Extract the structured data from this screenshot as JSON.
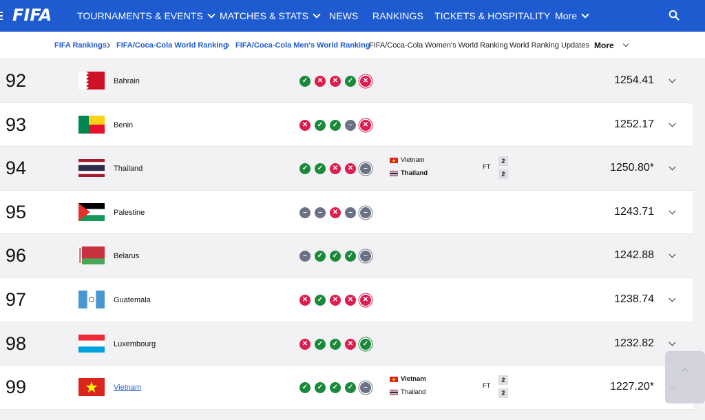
{
  "nav": {
    "logo": "FIFA",
    "items": [
      {
        "label": "TOURNAMENTS & EVENTS",
        "dropdown": true
      },
      {
        "label": "MATCHES & STATS",
        "dropdown": true
      },
      {
        "label": "NEWS",
        "dropdown": false
      },
      {
        "label": "RANKINGS",
        "dropdown": false
      },
      {
        "label": "TICKETS & HOSPITALITY",
        "dropdown": false
      },
      {
        "label": "More",
        "dropdown": true
      }
    ],
    "search_icon": "search-icon",
    "menu_icon": "hamburger-icon"
  },
  "breadcrumb": {
    "items": [
      {
        "label": "FIFA Rankings",
        "style": "link"
      },
      {
        "label": "FIFA/Coca-Cola World Ranking",
        "style": "link"
      },
      {
        "label": "FIFA/Coca-Cola Men's World Ranking",
        "style": "link"
      },
      {
        "label": "FIFA/Coca-Cola Women's World Ranking",
        "style": "plain"
      },
      {
        "label": "World Ranking Updates",
        "style": "plain"
      }
    ],
    "more_label": "More"
  },
  "colors": {
    "brand": "#1e5bd0",
    "win": "#1a8a3a",
    "loss": "#dc1d4e",
    "draw": "#6b7286"
  },
  "rows": [
    {
      "rank": "92",
      "country": "Bahrain",
      "flag": "bahrain",
      "form": [
        "W",
        "L",
        "L",
        "W",
        "L"
      ],
      "points": "1254.41",
      "match": null,
      "link": false
    },
    {
      "rank": "93",
      "country": "Benin",
      "flag": "benin",
      "form": [
        "L",
        "W",
        "W",
        "D",
        "L"
      ],
      "points": "1252.17",
      "match": null,
      "link": false
    },
    {
      "rank": "94",
      "country": "Thailand",
      "flag": "thailand",
      "form": [
        "W",
        "W",
        "L",
        "L",
        "D"
      ],
      "points": "1250.80*",
      "match": {
        "team1": "Vietnam",
        "team1_flag": "vietnam",
        "team2": "Thailand",
        "team2_flag": "thailand",
        "bold": 2,
        "status": "FT",
        "score1": "2",
        "score2": "2"
      },
      "link": false
    },
    {
      "rank": "95",
      "country": "Palestine",
      "flag": "palestine",
      "form": [
        "D",
        "D",
        "L",
        "D",
        "D"
      ],
      "points": "1243.71",
      "match": null,
      "link": false
    },
    {
      "rank": "96",
      "country": "Belarus",
      "flag": "belarus",
      "form": [
        "D",
        "W",
        "W",
        "W",
        "D"
      ],
      "points": "1242.88",
      "match": null,
      "link": false
    },
    {
      "rank": "97",
      "country": "Guatemala",
      "flag": "guatemala",
      "form": [
        "L",
        "W",
        "L",
        "L",
        "L"
      ],
      "points": "1238.74",
      "match": null,
      "link": false
    },
    {
      "rank": "98",
      "country": "Luxembourg",
      "flag": "luxembourg",
      "form": [
        "L",
        "W",
        "W",
        "L",
        "W"
      ],
      "points": "1232.82",
      "match": null,
      "link": false
    },
    {
      "rank": "99",
      "country": "Vietnam",
      "flag": "vietnam",
      "form": [
        "W",
        "W",
        "W",
        "W",
        "D"
      ],
      "points": "1227.20*",
      "match": {
        "team1": "Vietnam",
        "team1_flag": "vietnam",
        "team2": "Thailand",
        "team2_flag": "thailand",
        "bold": 1,
        "status": "FT",
        "score1": "2",
        "score2": "2"
      },
      "link": true
    }
  ]
}
